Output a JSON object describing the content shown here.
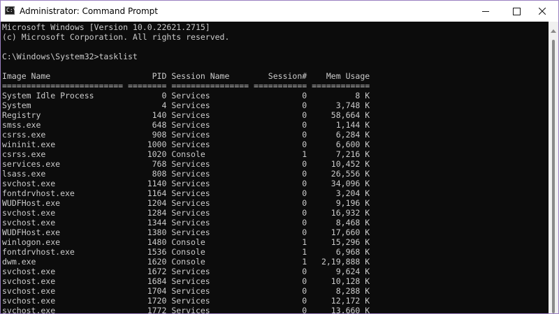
{
  "window": {
    "title": "Administrator: Command Prompt",
    "icon_glyph": "C:\\",
    "icon_name": "command-prompt-icon",
    "controls": {
      "minimize_icon": "minimize-icon",
      "maximize_icon": "maximize-icon",
      "close_icon": "close-icon"
    }
  },
  "console": {
    "lines": [
      "Microsoft Windows [Version 10.0.22621.2715]",
      "(c) Microsoft Corporation. All rights reserved.",
      "",
      "C:\\Windows\\System32>tasklist",
      "",
      "Image Name                     PID Session Name        Session#    Mem Usage",
      "========================= ======== ================ =========== ============",
      "System Idle Process              0 Services                   0          8 K",
      "System                           4 Services                   0      3,748 K",
      "Registry                       140 Services                   0     58,664 K",
      "smss.exe                       648 Services                   0      1,144 K",
      "csrss.exe                      908 Services                   0      6,284 K",
      "wininit.exe                   1000 Services                   0      6,600 K",
      "csrss.exe                     1020 Console                    1      7,216 K",
      "services.exe                   768 Services                   0     10,452 K",
      "lsass.exe                      808 Services                   0     26,556 K",
      "svchost.exe                   1140 Services                   0     34,096 K",
      "fontdrvhost.exe               1164 Services                   0      3,204 K",
      "WUDFHost.exe                  1204 Services                   0      9,196 K",
      "svchost.exe                   1284 Services                   0     16,932 K",
      "svchost.exe                   1344 Services                   0      8,468 K",
      "WUDFHost.exe                  1380 Services                   0     17,660 K",
      "winlogon.exe                  1480 Console                    1     15,296 K",
      "fontdrvhost.exe               1536 Console                    1      6,968 K",
      "dwm.exe                       1620 Console                    1   2,19,888 K",
      "svchost.exe                   1672 Services                   0      9,624 K",
      "svchost.exe                   1684 Services                   0     10,128 K",
      "svchost.exe                   1704 Services                   0      8,288 K",
      "svchost.exe                   1720 Services                   0     12,172 K",
      "svchost.exe                   1772 Services                   0     13,660 K"
    ]
  }
}
